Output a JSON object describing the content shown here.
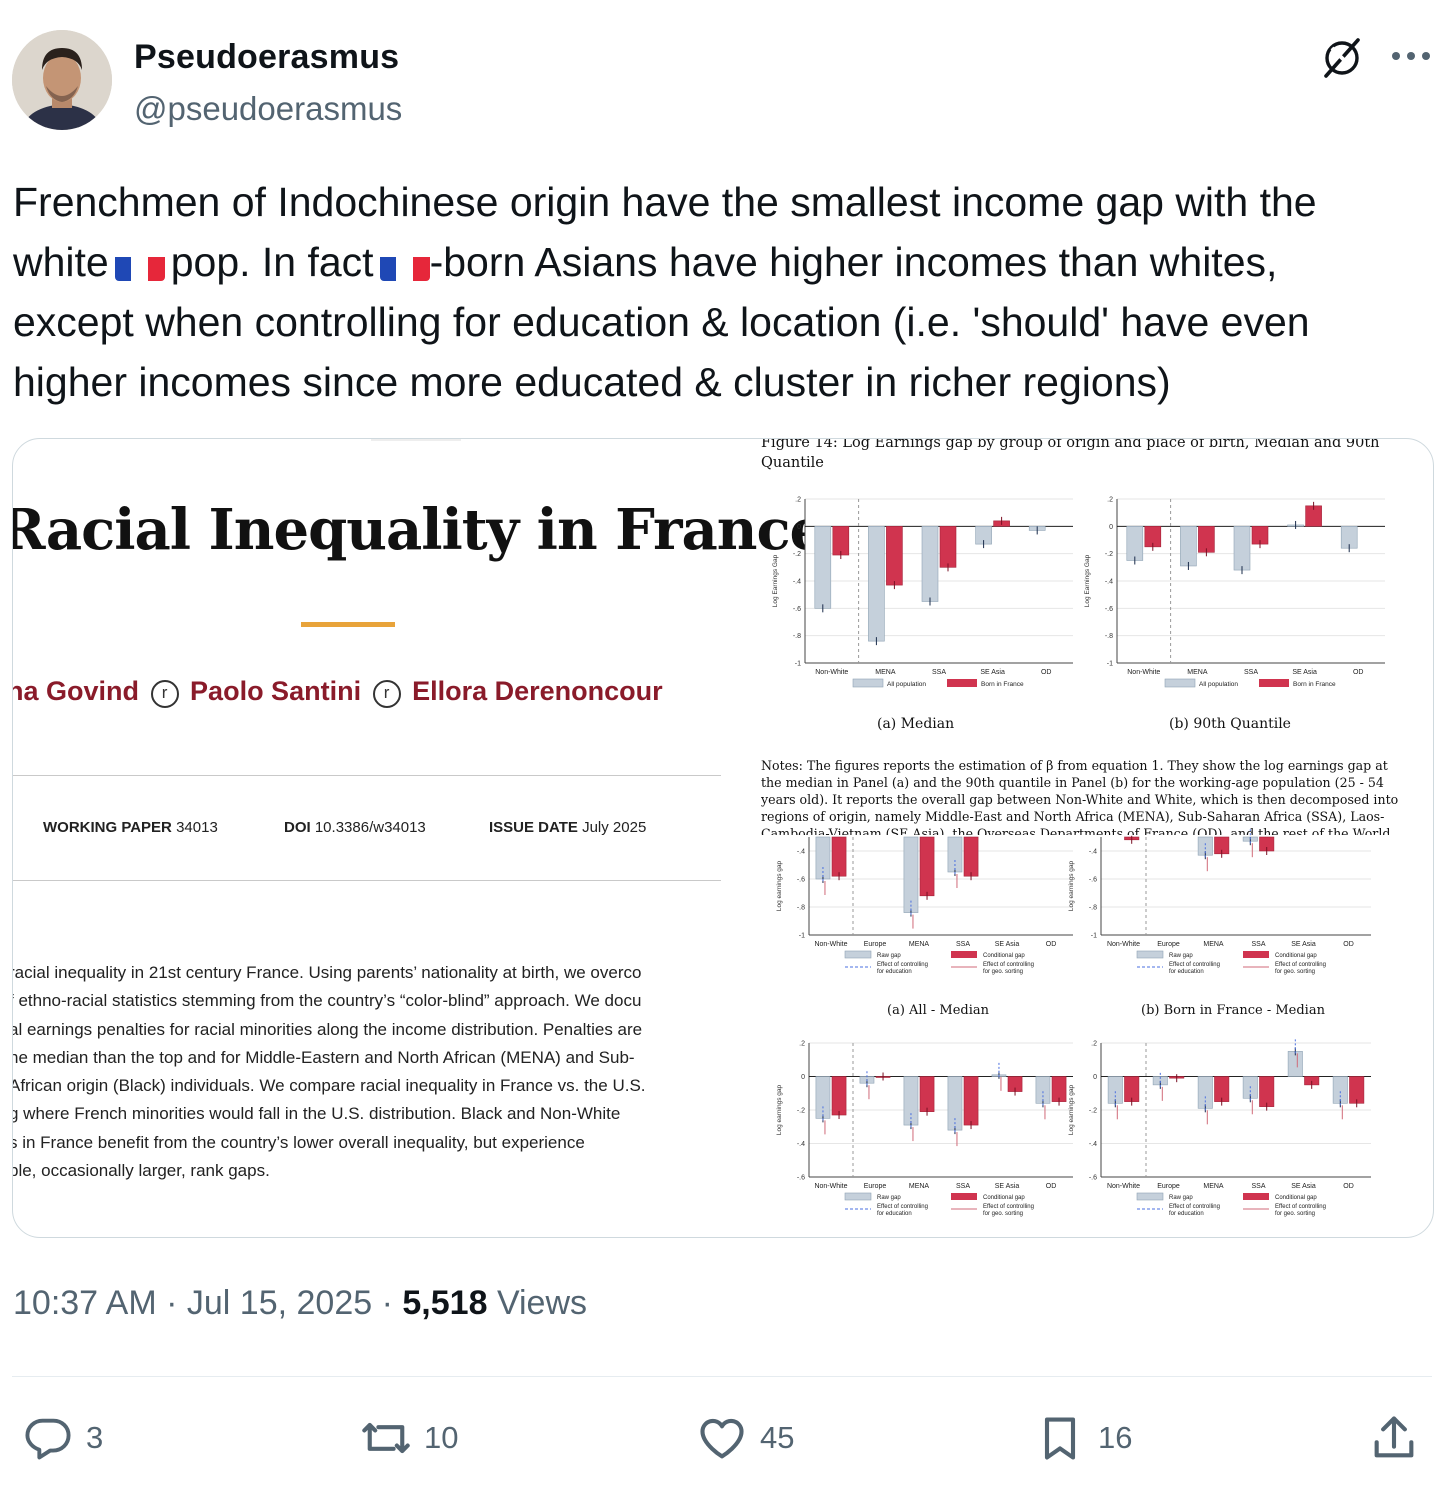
{
  "author": {
    "name": "Pseudoerasmus",
    "handle": "@pseudoerasmus"
  },
  "tweet": {
    "line1": "Frenchmen of Indochinese origin have the smallest income gap with the",
    "line2_a": "white",
    "line2_b": "pop. In fact",
    "line2_c": "-born Asians have higher incomes than whites,",
    "line3": "except when controlling for education & location (i.e. 'should' have even",
    "line4": "higher incomes since more educated & cluster in richer regions)"
  },
  "paper": {
    "title": "Racial Inequality in France",
    "authors": {
      "a1": "na Govind",
      "a2": "Paolo Santini",
      "a3": "Ellora Derenoncour",
      "sep": "r"
    },
    "meta": {
      "wp_label": "WORKING PAPER",
      "wp_value": "34013",
      "doi_label": "DOI",
      "doi_value": "10.3386/w34013",
      "issue_label": "ISSUE DATE",
      "issue_value": "July 2025"
    },
    "abstract_lines": [
      " racial inequality in 21st century France. Using parents’ nationality at birth, we overco",
      "f ethno-racial statistics stemming from the country’s “color-blind” approach. We docu",
      "al earnings penalties for racial minorities along the income distribution. Penalties are",
      "he median than the top and for Middle-Eastern and North African (MENA) and Sub-",
      "African origin (Black) individuals. We compare racial inequality in France vs. the U.S.",
      "g where French minorities would fall in the U.S. distribution. Black and Non-White",
      "s in France benefit from the country’s lower overall inequality, but experience",
      "ble, occasionally larger, rank gaps."
    ]
  },
  "figure": {
    "caption_line1": "Figure 14: Log Earnings gap by group of origin and place of birth, Median and 90th",
    "caption_line2": "Quantile",
    "panel_a": "(a) Median",
    "panel_b": "(b) 90th Quantile",
    "notes": "Notes: The figures reports the estimation of β from equation 1. They show the log earnings gap at the median in Panel (a) and the 90th quantile in Panel (b) for the working-age population (25 - 54 years old). It reports the overall gap between Non-White and White, which is then decomposed into regions of origin, namely Middle-East and North Africa (MENA), Sub-Saharan Africa (SSA), Laos-Cambodia-Vietnam (SE Asia), the Overseas Departments of France (OD), and the rest of the World (Others). Data:",
    "sub_a": "(a) All - Median",
    "sub_b": "(b) Born in France - Median",
    "ylabel_top": "Log Earnings Gap",
    "ylabel_low": "Log earnings gap",
    "legend_all": "All population",
    "legend_born": "Born in France",
    "legend_raw": "Raw gap",
    "legend_cond": "Conditional gap",
    "legend_edu_1": "Effect of controlling",
    "legend_edu_2": "for education",
    "legend_geo_1": "Effect of controlling",
    "legend_geo_2": "for geo. sorting",
    "colors": {
      "gray": "#c5d0db",
      "red": "#d0344f"
    }
  },
  "chart_data": [
    {
      "type": "bar",
      "title": "(a) Median",
      "ylabel": "Log Earnings Gap",
      "ylim": [
        -1,
        0.2
      ],
      "categories": [
        "Non-White",
        "MENA",
        "SSA",
        "SE Asia",
        "OD"
      ],
      "yticks": [
        ".2",
        "0",
        "-.2",
        "-.4",
        "-.6",
        "-.8",
        "-1"
      ],
      "series": [
        {
          "name": "All population",
          "values": [
            -0.6,
            -0.84,
            -0.55,
            -0.13,
            -0.03
          ]
        },
        {
          "name": "Born in France",
          "values": [
            -0.21,
            -0.43,
            -0.3,
            0.04,
            null
          ]
        }
      ]
    },
    {
      "type": "bar",
      "title": "(b) 90th Quantile",
      "ylabel": "Log Earnings Gap",
      "ylim": [
        -1,
        0.2
      ],
      "categories": [
        "Non-White",
        "MENA",
        "SSA",
        "SE Asia",
        "OD"
      ],
      "yticks": [
        ".2",
        "0",
        "-.2",
        "-.4",
        "-.6",
        "-.8",
        "-1"
      ],
      "series": [
        {
          "name": "All population",
          "values": [
            -0.25,
            -0.29,
            -0.32,
            0.01,
            -0.16
          ]
        },
        {
          "name": "Born in France",
          "values": [
            -0.15,
            -0.19,
            -0.13,
            0.15,
            null
          ]
        }
      ]
    },
    {
      "type": "bar",
      "title": "(a) All - Median",
      "ylabel": "Log earnings gap",
      "ylim": [
        -1,
        -0.3
      ],
      "categories": [
        "Non-White",
        "Europe",
        "MENA",
        "SSA",
        "SE Asia",
        "OD"
      ],
      "yticks": [
        "-.4",
        "-.6",
        "-.8",
        "-1"
      ],
      "series": [
        {
          "name": "Raw gap",
          "values": [
            -0.6,
            null,
            -0.84,
            -0.55,
            null,
            null
          ]
        },
        {
          "name": "Conditional gap",
          "values": [
            -0.58,
            null,
            -0.72,
            -0.58,
            null,
            null
          ]
        }
      ]
    },
    {
      "type": "bar",
      "title": "(b) Born in France - Median",
      "ylabel": "Log earnings gap",
      "ylim": [
        -1,
        -0.3
      ],
      "categories": [
        "Non-White",
        "Europe",
        "MENA",
        "SSA",
        "SE Asia",
        "OD"
      ],
      "yticks": [
        "-.4",
        "-.6",
        "-.8",
        "-1"
      ],
      "series": [
        {
          "name": "Raw gap",
          "values": [
            null,
            null,
            -0.43,
            -0.33,
            null,
            null
          ]
        },
        {
          "name": "Conditional gap",
          "values": [
            -0.32,
            null,
            -0.42,
            -0.4,
            null,
            null
          ]
        }
      ]
    },
    {
      "type": "bar",
      "title": "",
      "ylabel": "Log earnings gap",
      "ylim": [
        -0.6,
        0.2
      ],
      "categories": [
        "Non-White",
        "Europe",
        "MENA",
        "SSA",
        "SE Asia",
        "OD"
      ],
      "yticks": [
        ".2",
        "0",
        "-.2",
        "-.4",
        "-.6"
      ],
      "series": [
        {
          "name": "Raw gap",
          "values": [
            -0.25,
            -0.04,
            -0.29,
            -0.32,
            0.01,
            -0.16
          ]
        },
        {
          "name": "Conditional gap",
          "values": [
            -0.23,
            0.0,
            -0.21,
            -0.29,
            -0.09,
            -0.15
          ]
        }
      ]
    },
    {
      "type": "bar",
      "title": "",
      "ylabel": "Log earnings gap",
      "ylim": [
        -0.6,
        0.2
      ],
      "categories": [
        "Non-White",
        "Europe",
        "MENA",
        "SSA",
        "SE Asia",
        "OD"
      ],
      "yticks": [
        ".2",
        "0",
        "-.2",
        "-.4",
        "-.6"
      ],
      "series": [
        {
          "name": "Raw gap",
          "values": [
            -0.16,
            -0.05,
            -0.19,
            -0.13,
            0.15,
            -0.16
          ]
        },
        {
          "name": "Conditional gap",
          "values": [
            -0.15,
            -0.01,
            -0.15,
            -0.18,
            -0.05,
            -0.16
          ]
        }
      ]
    }
  ],
  "footer": {
    "time": "10:37 AM",
    "sep": "·",
    "date": "Jul 15, 2025",
    "views_count": "5,518",
    "views_label": "Views",
    "replies": "3",
    "reposts": "10",
    "likes": "45",
    "bookmarks": "16"
  },
  "icons": {
    "grok": "grok-icon",
    "more": "more-icon",
    "reply": "reply-icon",
    "repost": "repost-icon",
    "like": "like-icon",
    "bookmark": "bookmark-icon",
    "share": "share-icon"
  }
}
